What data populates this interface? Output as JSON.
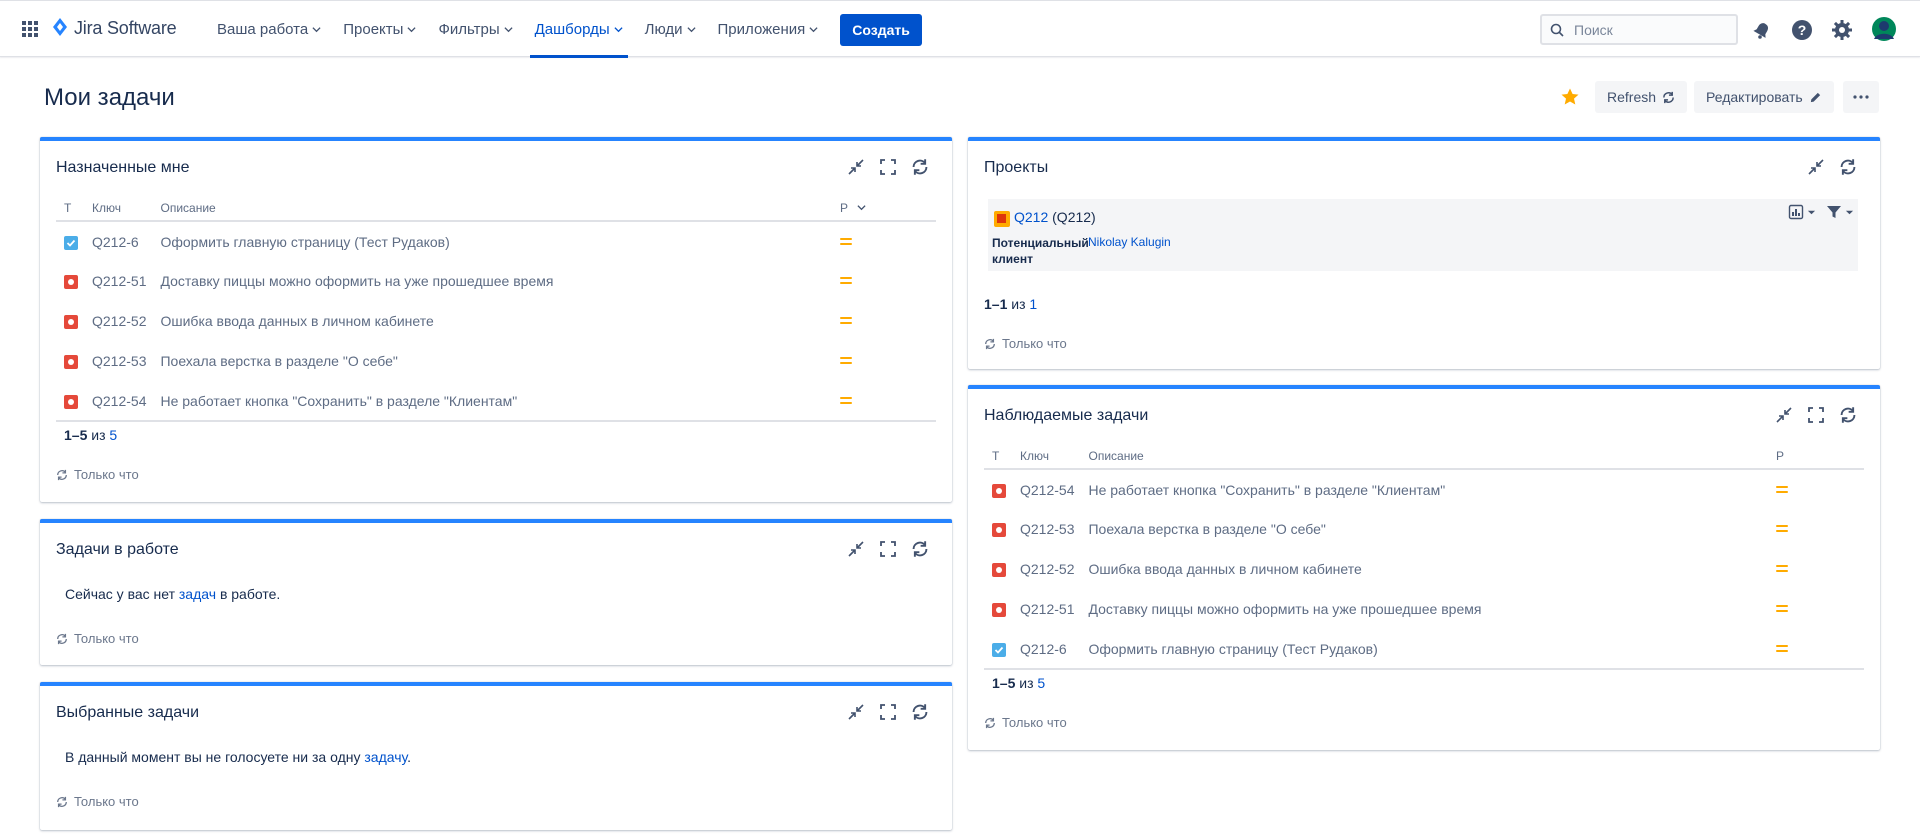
{
  "app": {
    "logo_text": "Jira Software"
  },
  "nav": {
    "items": [
      {
        "label": "Ваша работа"
      },
      {
        "label": "Проекты"
      },
      {
        "label": "Фильтры"
      },
      {
        "label": "Дашборды"
      },
      {
        "label": "Люди"
      },
      {
        "label": "Приложения"
      }
    ],
    "active": "Дашборды",
    "create_label": "Создать",
    "search_placeholder": "Поиск"
  },
  "page": {
    "title": "Мои задачи",
    "refresh_label": "Refresh",
    "edit_label": "Редактировать"
  },
  "assigned": {
    "title": "Назначенные мне",
    "columns": {
      "type": "T",
      "key": "Ключ",
      "summary": "Описание",
      "priority": "P"
    },
    "rows": [
      {
        "type": "task",
        "key": "Q212-6",
        "summary": "Оформить главную страницу (Тест Рудаков)",
        "priority": "medium"
      },
      {
        "type": "bug",
        "key": "Q212-51",
        "summary": "Доставку пиццы можно оформить на уже прошедшее время",
        "priority": "medium"
      },
      {
        "type": "bug",
        "key": "Q212-52",
        "summary": "Ошибка ввода данных в личном кабинете",
        "priority": "medium"
      },
      {
        "type": "bug",
        "key": "Q212-53",
        "summary": "Поехала верстка в разделе \"О себе\"",
        "priority": "medium"
      },
      {
        "type": "bug",
        "key": "Q212-54",
        "summary": "Не работает кнопка \"Сохранить\" в разделе \"Клиентам\"",
        "priority": "medium"
      }
    ],
    "pager": {
      "range": "1–5",
      "of": "из",
      "total": "5"
    },
    "updated": "Только что"
  },
  "in_progress": {
    "title": "Задачи в работе",
    "msg_before": "Сейчас у вас нет",
    "msg_link": "задач",
    "msg_after": "в работе.",
    "updated": "Только что"
  },
  "voted": {
    "title": "Выбранные задачи",
    "msg_before": "В данный момент вы не голосуете ни за одну",
    "msg_link": "задачу",
    "msg_after": ".",
    "updated": "Только что"
  },
  "projects": {
    "title": "Проекты",
    "project_name": "Q212",
    "project_key": "(Q212)",
    "lead_label": "Потенциальный клиент",
    "lead_name": "Nikolay Kalugin",
    "pager": {
      "range": "1–1",
      "of": "из",
      "total": "1"
    },
    "updated": "Только что"
  },
  "watched": {
    "title": "Наблюдаемые задачи",
    "columns": {
      "type": "T",
      "key": "Ключ",
      "summary": "Описание",
      "priority": "P"
    },
    "rows": [
      {
        "type": "bug",
        "key": "Q212-54",
        "summary": "Не работает кнопка \"Сохранить\" в разделе \"Клиентам\"",
        "priority": "medium"
      },
      {
        "type": "bug",
        "key": "Q212-53",
        "summary": "Поехала верстка в разделе \"О себе\"",
        "priority": "medium"
      },
      {
        "type": "bug",
        "key": "Q212-52",
        "summary": "Ошибка ввода данных в личном кабинете",
        "priority": "medium"
      },
      {
        "type": "bug",
        "key": "Q212-51",
        "summary": "Доставку пиццы можно оформить на уже прошедшее время",
        "priority": "medium"
      },
      {
        "type": "task",
        "key": "Q212-6",
        "summary": "Оформить главную страницу (Тест Рудаков)",
        "priority": "medium"
      }
    ],
    "pager": {
      "range": "1–5",
      "of": "из",
      "total": "5"
    },
    "updated": "Только что"
  },
  "colors": {
    "brand": "#0052cc",
    "gadget_accent": "#2684ff",
    "bug": "#e5493a",
    "task": "#4bade8",
    "priority_medium": "#ffab00",
    "star": "#ffab00"
  },
  "icons": [
    "apps-grid-icon",
    "jira-logo-icon",
    "chevron-down-icon",
    "search-icon",
    "notifications-icon",
    "help-icon",
    "settings-icon",
    "avatar-icon",
    "star-icon",
    "refresh-icon",
    "pencil-icon",
    "more-icon",
    "minimize-icon",
    "maximize-icon",
    "task-icon",
    "bug-icon",
    "priority-medium-icon",
    "chart-icon",
    "filter-icon"
  ]
}
